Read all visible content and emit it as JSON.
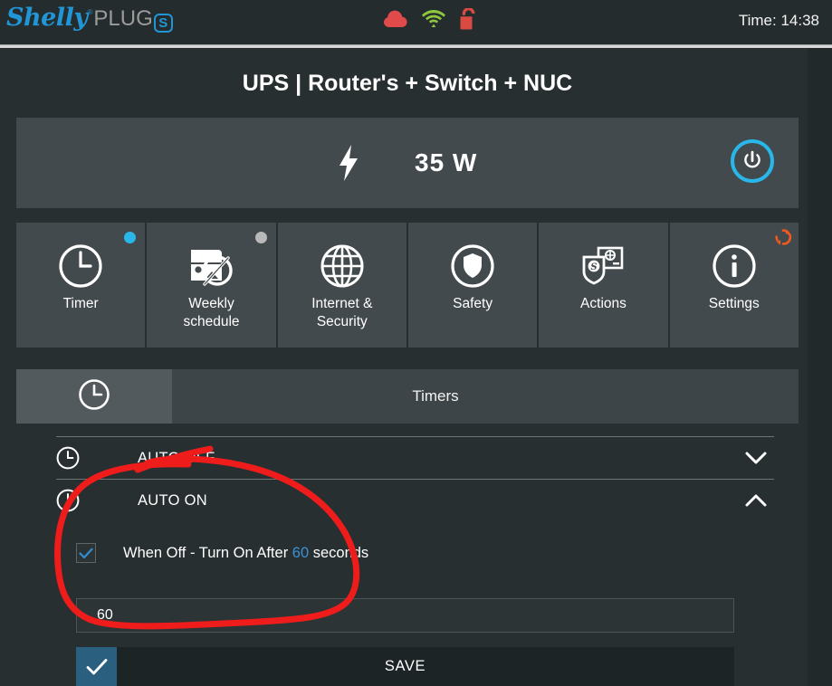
{
  "topbar": {
    "logo": {
      "brand": "Shelly",
      "reg": "®",
      "product": "PLUG",
      "variant": "S"
    },
    "icons": [
      {
        "name": "cloud-icon",
        "color": "#e04a4a"
      },
      {
        "name": "wifi-icon",
        "color": "#8ec63f"
      },
      {
        "name": "lock-open-icon",
        "color": "#d94a42"
      }
    ],
    "time_label": "Time: 14:38"
  },
  "page": {
    "title": "UPS | Router's + Switch + NUC"
  },
  "power": {
    "bolt_icon": "lightning-bolt-icon",
    "value": "35 W",
    "toggle_icon": "power-button-icon",
    "accent": "#29b6e8"
  },
  "nav": {
    "tiles": [
      {
        "label": "Timer",
        "icon": "clock-icon",
        "badge": "blue-dot"
      },
      {
        "label": "Weekly\nschedule",
        "label_line1": "Weekly",
        "label_line2": "schedule",
        "icon": "calendar-disabled-icon",
        "badge": "gray-dot"
      },
      {
        "label": "Internet &\nSecurity",
        "label_line1": "Internet &",
        "label_line2": "Security",
        "icon": "globe-icon",
        "badge": "none"
      },
      {
        "label": "Safety",
        "icon": "shield-icon",
        "badge": "none"
      },
      {
        "label": "Actions",
        "icon": "actions-icon",
        "badge": "none"
      },
      {
        "label": "Settings",
        "icon": "info-icon",
        "badge": "orange-refresh"
      }
    ]
  },
  "timers": {
    "tab_icon": "clock-icon",
    "heading": "Timers",
    "items": [
      {
        "title": "AUTO OFF",
        "icon": "clock-icon",
        "chevron": "chevron-down-icon",
        "expanded": false
      },
      {
        "title": "AUTO ON",
        "icon": "clock-icon",
        "chevron": "chevron-up-icon",
        "expanded": true
      }
    ],
    "auto_on": {
      "checkbox_checked": true,
      "label_prefix": "When Off - Turn On After ",
      "label_number": "60",
      "label_suffix": " seconds",
      "input_value": "60",
      "number_color": "#3b93d6"
    },
    "save": {
      "label": "SAVE",
      "check_icon": "check-icon"
    }
  },
  "annotation": {
    "color": "#ef1c1c",
    "shape": "hand-drawn-oval-highlight"
  }
}
